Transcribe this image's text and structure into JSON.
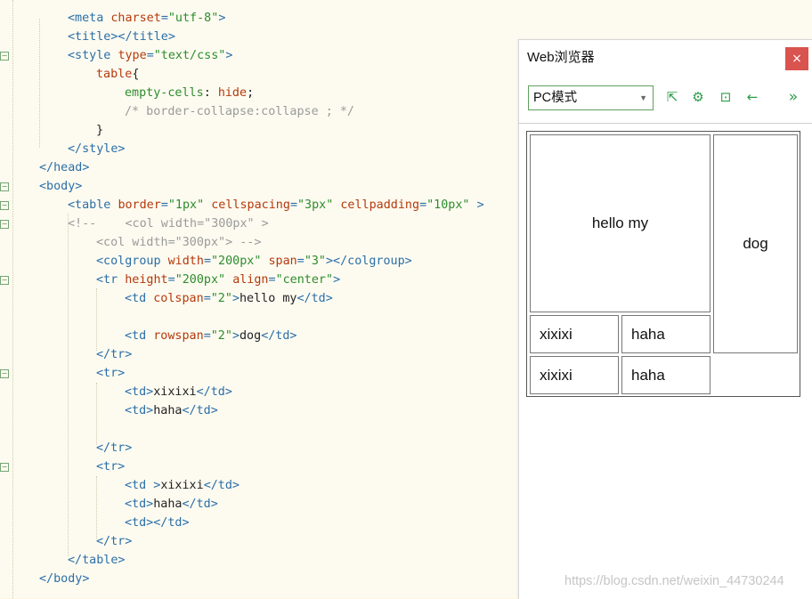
{
  "editor": {
    "lines": [
      [
        {
          "c": "t-tag",
          "t": "<meta "
        },
        {
          "c": "t-attr",
          "t": "charset"
        },
        {
          "c": "t-tag",
          "t": "="
        },
        {
          "c": "t-val",
          "t": "\"utf-8\""
        },
        {
          "c": "t-tag",
          "t": ">"
        }
      ],
      [
        {
          "c": "t-tag",
          "t": "<title></title>"
        }
      ],
      [
        {
          "c": "t-tag",
          "t": "<style "
        },
        {
          "c": "t-attr",
          "t": "type"
        },
        {
          "c": "t-tag",
          "t": "="
        },
        {
          "c": "t-val",
          "t": "\"text/css\""
        },
        {
          "c": "t-tag",
          "t": ">"
        }
      ],
      [
        {
          "c": "t-attr",
          "t": "table"
        },
        {
          "c": "t-text",
          "t": "{"
        }
      ],
      [
        {
          "c": "t-prop",
          "t": "empty-cells"
        },
        {
          "c": "t-text",
          "t": ": "
        },
        {
          "c": "t-attr",
          "t": "hide"
        },
        {
          "c": "t-text",
          "t": ";"
        }
      ],
      [
        {
          "c": "t-com",
          "t": "/* border-collapse:collapse ; */"
        }
      ],
      [
        {
          "c": "t-text",
          "t": "}"
        }
      ],
      [
        {
          "c": "t-tag",
          "t": "</style>"
        }
      ],
      [
        {
          "c": "t-tag",
          "t": "</head>"
        }
      ],
      [
        {
          "c": "t-tag",
          "t": "<body>"
        }
      ],
      [
        {
          "c": "t-tag",
          "t": "<table "
        },
        {
          "c": "t-attr",
          "t": "border"
        },
        {
          "c": "t-tag",
          "t": "="
        },
        {
          "c": "t-val",
          "t": "\"1px\" "
        },
        {
          "c": "t-attr",
          "t": "cellspacing"
        },
        {
          "c": "t-tag",
          "t": "="
        },
        {
          "c": "t-val",
          "t": "\"3px\" "
        },
        {
          "c": "t-attr",
          "t": "cellpadding"
        },
        {
          "c": "t-tag",
          "t": "="
        },
        {
          "c": "t-val",
          "t": "\"10px\" "
        },
        {
          "c": "t-tag",
          "t": ">"
        }
      ],
      [
        {
          "c": "t-com",
          "t": "<!--    <col width=\"300px\" >"
        }
      ],
      [
        {
          "c": "t-com",
          "t": "<col width=\"300px\"> -->"
        }
      ],
      [
        {
          "c": "t-tag",
          "t": "<colgroup "
        },
        {
          "c": "t-attr",
          "t": "width"
        },
        {
          "c": "t-tag",
          "t": "="
        },
        {
          "c": "t-val",
          "t": "\"200px\" "
        },
        {
          "c": "t-attr",
          "t": "span"
        },
        {
          "c": "t-tag",
          "t": "="
        },
        {
          "c": "t-val",
          "t": "\"3\""
        },
        {
          "c": "t-tag",
          "t": "></colgroup>"
        }
      ],
      [
        {
          "c": "t-tag",
          "t": "<tr "
        },
        {
          "c": "t-attr",
          "t": "height"
        },
        {
          "c": "t-tag",
          "t": "="
        },
        {
          "c": "t-val",
          "t": "\"200px\" "
        },
        {
          "c": "t-attr",
          "t": "align"
        },
        {
          "c": "t-tag",
          "t": "="
        },
        {
          "c": "t-val",
          "t": "\"center\""
        },
        {
          "c": "t-tag",
          "t": ">"
        }
      ],
      [
        {
          "c": "t-tag",
          "t": "<td "
        },
        {
          "c": "t-attr",
          "t": "colspan"
        },
        {
          "c": "t-tag",
          "t": "="
        },
        {
          "c": "t-val",
          "t": "\"2\""
        },
        {
          "c": "t-tag",
          "t": ">"
        },
        {
          "c": "t-text",
          "t": "hello my"
        },
        {
          "c": "t-tag",
          "t": "</td>"
        }
      ],
      [],
      [
        {
          "c": "t-tag",
          "t": "<td "
        },
        {
          "c": "t-attr",
          "t": "rowspan"
        },
        {
          "c": "t-tag",
          "t": "="
        },
        {
          "c": "t-val",
          "t": "\"2\""
        },
        {
          "c": "t-tag",
          "t": ">"
        },
        {
          "c": "t-text",
          "t": "dog"
        },
        {
          "c": "t-tag",
          "t": "</td>"
        }
      ],
      [
        {
          "c": "t-tag",
          "t": "</tr>"
        }
      ],
      [
        {
          "c": "t-tag",
          "t": "<tr>"
        }
      ],
      [
        {
          "c": "t-tag",
          "t": "<td>"
        },
        {
          "c": "t-text",
          "t": "xixixi"
        },
        {
          "c": "t-tag",
          "t": "</td>"
        }
      ],
      [
        {
          "c": "t-tag",
          "t": "<td>"
        },
        {
          "c": "t-text",
          "t": "haha"
        },
        {
          "c": "t-tag",
          "t": "</td>"
        }
      ],
      [],
      [
        {
          "c": "t-tag",
          "t": "</tr>"
        }
      ],
      [
        {
          "c": "t-tag",
          "t": "<tr>"
        }
      ],
      [
        {
          "c": "t-tag",
          "t": "<td "
        },
        {
          "c": "t-tag",
          "t": ">"
        },
        {
          "c": "t-text",
          "t": "xixixi"
        },
        {
          "c": "t-tag",
          "t": "</td>"
        }
      ],
      [
        {
          "c": "t-tag",
          "t": "<td>"
        },
        {
          "c": "t-text",
          "t": "haha"
        },
        {
          "c": "t-tag",
          "t": "</td>"
        }
      ],
      [
        {
          "c": "t-tag",
          "t": "<td></td>"
        }
      ],
      [
        {
          "c": "t-tag",
          "t": "</tr>"
        }
      ],
      [
        {
          "c": "t-tag",
          "t": "</table>"
        }
      ],
      [
        {
          "c": "t-tag",
          "t": "</body>"
        }
      ]
    ],
    "fold_marker": "−"
  },
  "browser": {
    "title": "Web浏览器",
    "close_label": "×",
    "mode": "PC模式",
    "icons": [
      "open-external-icon",
      "settings-gear-icon",
      "console-icon",
      "back-arrow-icon",
      "more-chevrons-icon"
    ],
    "icon_glyphs": [
      "⇱",
      "⚙",
      "⊡",
      "←",
      "»"
    ],
    "table": {
      "cells": [
        {
          "name": "cell-hello-my",
          "text": "hello my"
        },
        {
          "name": "cell-dog",
          "text": "dog"
        },
        {
          "name": "cell-xixixi-1",
          "text": "xixixi"
        },
        {
          "name": "cell-haha-1",
          "text": "haha"
        },
        {
          "name": "cell-xixixi-2",
          "text": "xixixi"
        },
        {
          "name": "cell-haha-2",
          "text": "haha"
        }
      ]
    }
  },
  "watermark": "https://blog.csdn.net/weixin_44730244"
}
